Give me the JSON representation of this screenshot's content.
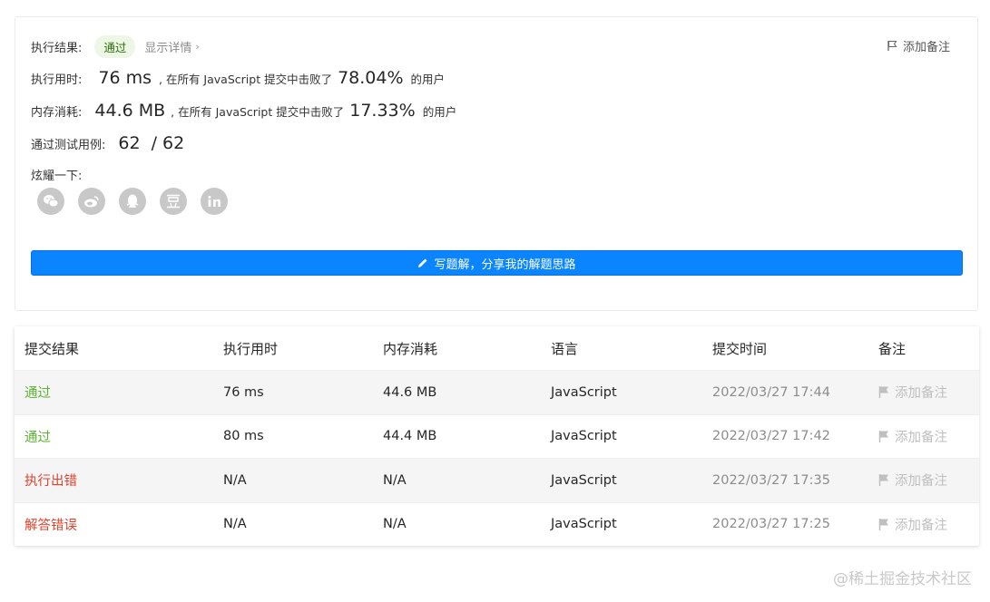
{
  "summary": {
    "result_label": "执行结果:",
    "status": "通过",
    "details_link": "显示详情",
    "add_note": "添加备注",
    "runtime_label": "执行用时:",
    "runtime_value": "76 ms",
    "runtime_beat_text": ", 在所有 JavaScript 提交中击败了",
    "runtime_pct": "78.04%",
    "runtime_users": "的用户",
    "memory_label": "内存消耗:",
    "memory_value": "44.6 MB",
    "memory_beat_text": ", 在所有 JavaScript 提交中击败了",
    "memory_pct": "17.33%",
    "memory_users": "的用户",
    "tests_label": "通过测试用例:",
    "tests_passed": "62",
    "tests_sep": "/",
    "tests_total": "62",
    "share_label": "炫耀一下:",
    "share_icons": [
      "wechat-icon",
      "weibo-icon",
      "qq-icon",
      "douban-icon",
      "linkedin-icon"
    ],
    "write_button": "写题解，分享我的解题思路"
  },
  "table": {
    "headers": [
      "提交结果",
      "执行用时",
      "内存消耗",
      "语言",
      "提交时间",
      "备注"
    ],
    "rows": [
      {
        "status": "通过",
        "status_type": "ok",
        "runtime": "76 ms",
        "memory": "44.6 MB",
        "language": "JavaScript",
        "time": "2022/03/27 17:44",
        "note": "添加备注"
      },
      {
        "status": "通过",
        "status_type": "ok",
        "runtime": "80 ms",
        "memory": "44.4 MB",
        "language": "JavaScript",
        "time": "2022/03/27 17:42",
        "note": "添加备注"
      },
      {
        "status": "执行出错",
        "status_type": "err",
        "runtime": "N/A",
        "memory": "N/A",
        "language": "JavaScript",
        "time": "2022/03/27 17:35",
        "note": "添加备注"
      },
      {
        "status": "解答错误",
        "status_type": "err",
        "runtime": "N/A",
        "memory": "N/A",
        "language": "JavaScript",
        "time": "2022/03/27 17:25",
        "note": "添加备注"
      }
    ]
  },
  "colors": {
    "accent": "#0a84ff",
    "ok": "#5cb230",
    "err": "#e0442e"
  },
  "watermark": "@稀土掘金技术社区"
}
